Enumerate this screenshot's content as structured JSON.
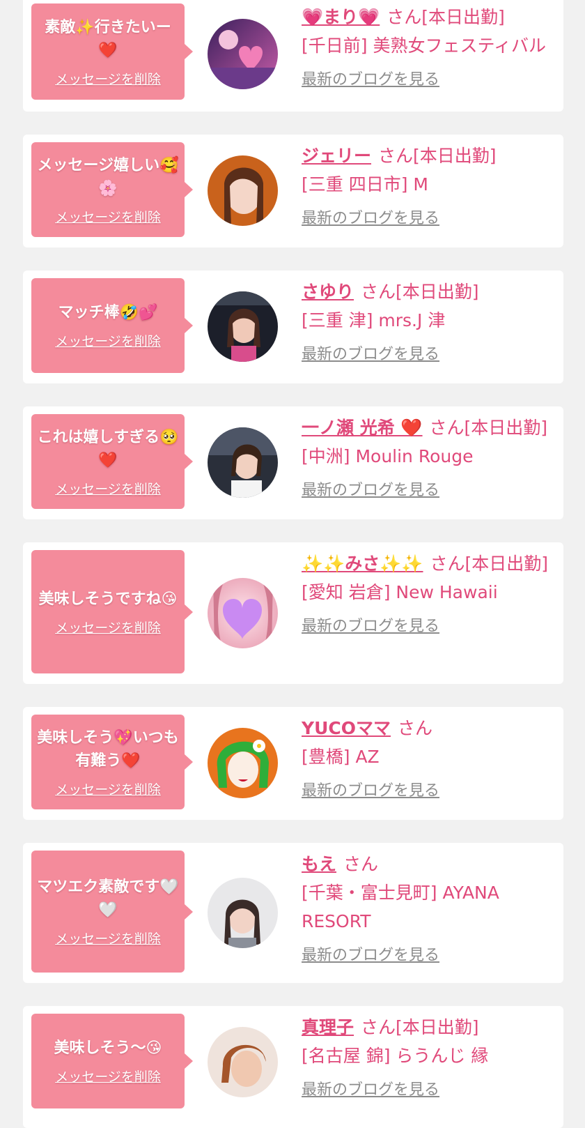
{
  "colors": {
    "page_background": "#f1f1f1",
    "card_background": "#ffffff",
    "bubble_background": "#f48b9b",
    "accent_pink": "#e0497a",
    "link_gray": "#8c8c8c"
  },
  "cards": [
    {
      "message": "素敵✨行きたいー❤️",
      "delete_label": "メッセージを削除",
      "name": "💗まり💗",
      "honorific": "さん[本日出勤]",
      "shop": "[千日前] 美熟女フェスティバル",
      "blog_label": "最新のブログを見る",
      "avatar_icon": "avatar-photo"
    },
    {
      "message": "メッセージ嬉しい🥰🌸",
      "delete_label": "メッセージを削除",
      "name": "ジェリー",
      "honorific": "さん[本日出勤]",
      "shop": "[三重 四日市] M",
      "blog_label": "最新のブログを見る",
      "avatar_icon": "avatar-photo"
    },
    {
      "message": "マッチ棒🤣💕",
      "delete_label": "メッセージを削除",
      "name": "さゆり",
      "honorific": "さん[本日出勤]",
      "shop": "[三重 津] mrs.J 津",
      "blog_label": "最新のブログを見る",
      "avatar_icon": "avatar-photo"
    },
    {
      "message": "これは嬉しすぎる🥺❤️",
      "delete_label": "メッセージを削除",
      "name": "一ノ瀬 光希 ❤️",
      "honorific": "さん[本日出勤]",
      "shop": "[中洲] Moulin Rouge",
      "blog_label": "最新のブログを見る",
      "avatar_icon": "avatar-photo"
    },
    {
      "message": "美味しそうですね😘",
      "delete_label": "メッセージを削除",
      "name": "✨✨みさ✨✨",
      "honorific": "さん[本日出勤]",
      "shop": "[愛知 岩倉] New Hawaii",
      "blog_label": "最新のブログを見る",
      "avatar_icon": "avatar-heart-blur"
    },
    {
      "message": "美味しそう💖いつも有難う❤️",
      "delete_label": "メッセージを削除",
      "name": "YUCOママ",
      "honorific": "さん",
      "shop": "[豊橋] AZ",
      "blog_label": "最新のブログを見る",
      "avatar_icon": "avatar-illustration"
    },
    {
      "message": "マツエク素敵です🤍🤍",
      "delete_label": "メッセージを削除",
      "name": "もえ",
      "honorific": "さん",
      "shop": "[千葉・富士見町] AYANA RESORT",
      "blog_label": "最新のブログを見る",
      "avatar_icon": "avatar-photo"
    },
    {
      "message": "美味しそう〜😘",
      "delete_label": "メッセージを削除",
      "name": "真理子",
      "honorific": "さん[本日出勤]",
      "shop": "[名古屋 錦] らうんじ 縁",
      "blog_label": "最新のブログを見る",
      "avatar_icon": "avatar-photo"
    }
  ]
}
